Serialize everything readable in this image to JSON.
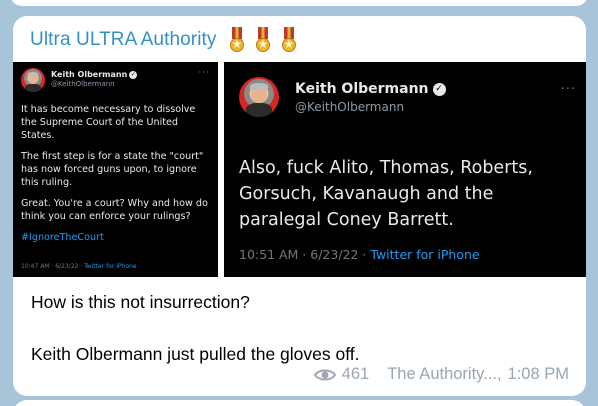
{
  "channel": {
    "name": "Ultra ULTRA Authority",
    "badge_icons": [
      "medal-icon",
      "medal-icon",
      "medal-icon"
    ]
  },
  "tweets": [
    {
      "author_name": "Keith Olbermann",
      "handle": "@KeithOlbermann",
      "paragraphs": [
        "It has become necessary to dissolve the Supreme Court of the United States.",
        "The first step is for a state the \"court\" has now forced guns upon, to ignore this ruling.",
        "Great. You're a court? Why and how do think you can enforce your rulings?"
      ],
      "hashtag": "#IgnoreTheCourt",
      "timestamp": "10:47 AM · 6/23/22 · ",
      "app": "Twitter for iPhone"
    },
    {
      "author_name": "Keith Olbermann",
      "handle": "@KeithOlbermann",
      "text": "Also, fuck Alito, Thomas, Roberts, Gorsuch, Kavanaugh and the paralegal Coney Barrett.",
      "timestamp": "10:51 AM · 6/23/22 · ",
      "app": "Twitter for iPhone"
    }
  ],
  "message": {
    "lines": [
      "How is this not insurrection?",
      "",
      "Keith Olbermann just pulled the gloves off."
    ],
    "views": "461",
    "author_signature": "The Authority...,",
    "time": "1:08 PM"
  },
  "colors": {
    "channel_name": "#3390c7",
    "chat_background": "#a8c4d8",
    "tweet_link": "#1d9bf0"
  }
}
